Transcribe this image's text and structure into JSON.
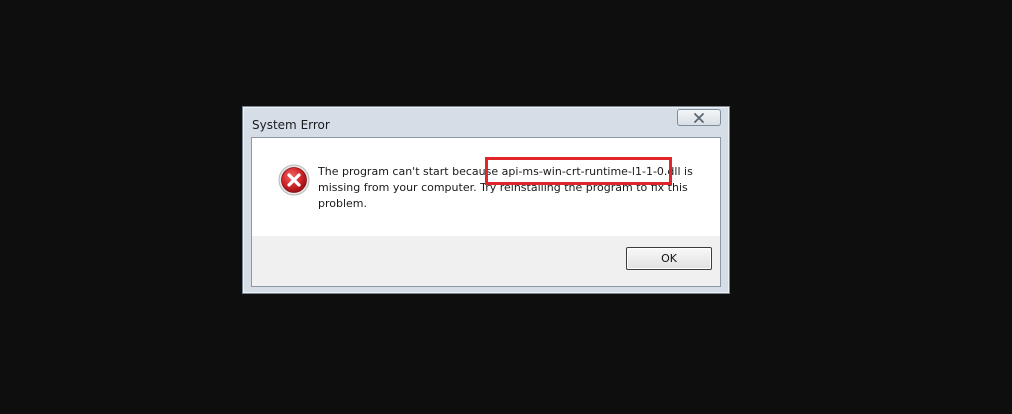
{
  "dialog": {
    "title": "System Error",
    "icon": "error-icon",
    "message_part1": "The program can't start because ",
    "message_dll": "api-ms-win-crt-runtime-l1-1-0.dll",
    "message_part2": " is missing from your computer. Try reinstalling the program to fix this problem.",
    "ok_label": "OK",
    "close_icon": "close-icon"
  },
  "colors": {
    "background": "#0e0e0f",
    "highlight": "#e0262b",
    "error_red": "#c4161c"
  }
}
